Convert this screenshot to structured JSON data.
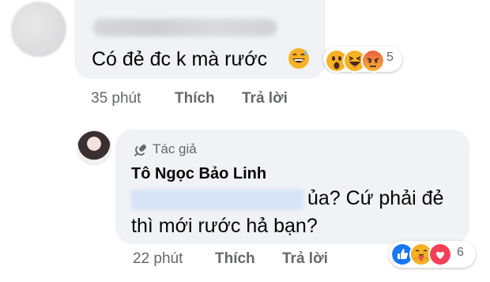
{
  "comment1": {
    "text": "Có đẻ đc k mà rước",
    "emoji": "grinning-sweat-emoji",
    "reactions": [
      "wow",
      "haha",
      "angry"
    ],
    "reaction_count": "5",
    "time": "35 phút",
    "like_label": "Thích",
    "reply_label": "Trả lời"
  },
  "comment2": {
    "badge": "Tác giả",
    "author": "Tô Ngọc Bảo Linh",
    "text_line1": "ủa? Cứ phải đẻ",
    "text_line2": "thì mới rước hả bạn?",
    "reactions": [
      "like",
      "care",
      "love"
    ],
    "reaction_count": "6",
    "time": "22 phút",
    "like_label": "Thích",
    "reply_label": "Trả lời"
  },
  "colors": {
    "bubble": "#f0f2f5",
    "meta_text": "#65676b",
    "like_blue": "#1877f2",
    "love_red": "#f33e58",
    "emoji_yellow": "#f7b125"
  }
}
